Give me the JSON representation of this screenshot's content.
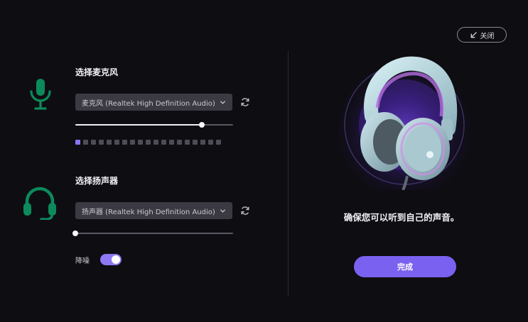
{
  "close_button": {
    "label": "关闭",
    "icon": "arrow-down-left-icon"
  },
  "microphone": {
    "title": "选择麦克风",
    "icon": "microphone-icon",
    "device": "麦克风 (Realtek High Definition Audio)",
    "volume_percent": 80,
    "meter_segments": 19,
    "meter_active": 1
  },
  "speaker": {
    "title": "选择扬声器",
    "icon": "headset-icon",
    "device": "扬声器 (Realtek High Definition Audio)",
    "volume_percent": 0
  },
  "noise_reduction": {
    "label": "降噪",
    "enabled": true
  },
  "preview": {
    "message": "确保您可以听到自己的声音。",
    "image": "headphones-illustration"
  },
  "done_button": {
    "label": "完成"
  },
  "colors": {
    "accent": "#7a61f0",
    "icon_green": "#0c8a5b",
    "background": "#0e0d12"
  }
}
